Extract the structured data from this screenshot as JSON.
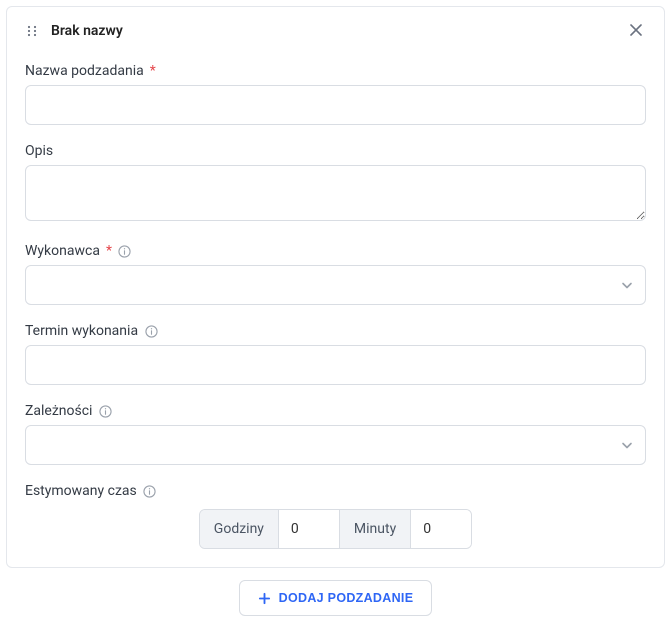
{
  "header": {
    "title": "Brak nazwy"
  },
  "fields": {
    "name": {
      "label": "Nazwa podzadania",
      "required_mark": "*",
      "value": ""
    },
    "description": {
      "label": "Opis",
      "value": ""
    },
    "assignee": {
      "label": "Wykonawca",
      "required_mark": "*",
      "value": ""
    },
    "deadline": {
      "label": "Termin wykonania",
      "value": ""
    },
    "dependencies": {
      "label": "Zależności",
      "value": ""
    },
    "estimate": {
      "label": "Estymowany czas",
      "hours_label": "Godziny",
      "hours_value": "0",
      "minutes_label": "Minuty",
      "minutes_value": "0"
    }
  },
  "footer": {
    "add_label": "DODAJ PODZADANIE"
  }
}
